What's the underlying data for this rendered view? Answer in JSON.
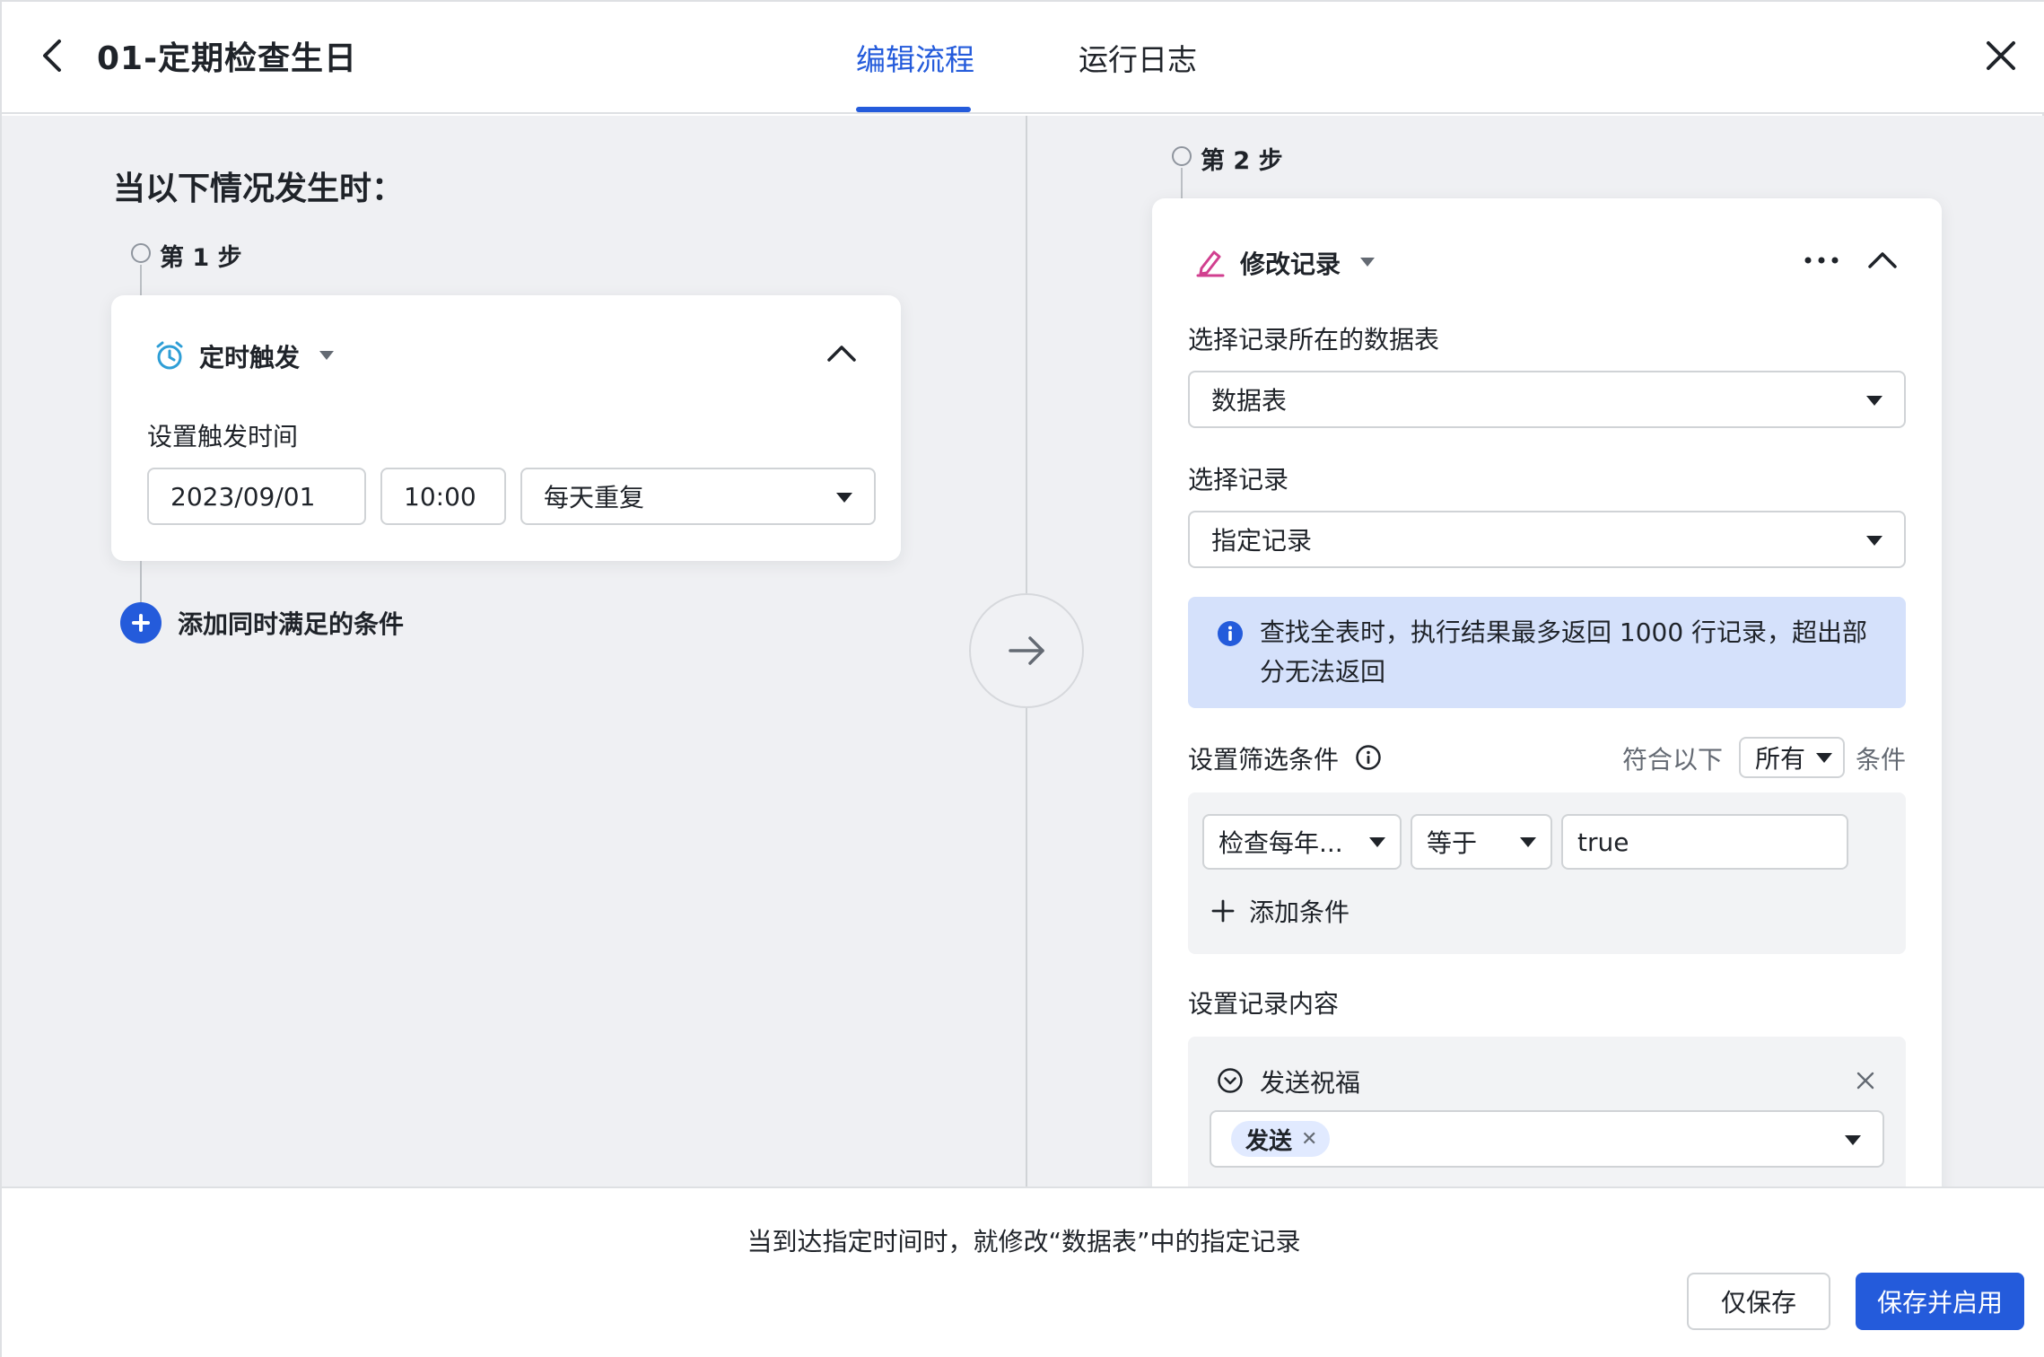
{
  "header": {
    "title": "01-定期检查生日",
    "tabs": [
      {
        "label": "编辑流程",
        "active": true
      },
      {
        "label": "运行日志",
        "active": false
      }
    ]
  },
  "left": {
    "heading": "当以下情况发生时：",
    "step1": {
      "label": "第 1 步",
      "card": {
        "icon": "alarm-clock-icon",
        "title": "定时触发",
        "field_label": "设置触发时间",
        "date": "2023/09/01",
        "time": "10:00",
        "repeat": "每天重复"
      }
    },
    "add_condition_label": "添加同时满足的条件"
  },
  "right": {
    "step2": {
      "label": "第 2 步",
      "card": {
        "icon": "edit-pencil-icon",
        "title": "修改记录",
        "table_label": "选择记录所在的数据表",
        "table_value": "数据表",
        "record_label": "选择记录",
        "record_value": "指定记录",
        "info_text": "查找全表时，执行结果最多返回 1000 行记录，超出部分无法返回",
        "filter_label": "设置筛选条件",
        "match_prefix": "符合以下",
        "match_value": "所有",
        "match_suffix": "条件",
        "condition": {
          "field": "检查每年...",
          "operator": "等于",
          "value": "true"
        },
        "add_condition": "添加条件",
        "content_label": "设置记录内容",
        "content_field": "发送祝福",
        "content_tag": "发送"
      }
    }
  },
  "footer": {
    "summary": "当到达指定时间时，就修改“数据表”中的指定记录",
    "save_only": "仅保存",
    "save_enable": "保存并启用"
  },
  "colors": {
    "primary": "#245bdb",
    "canvas_bg": "#eff0f3",
    "info_bg": "#d5e1fb",
    "trigger_icon": "#2e9ed6",
    "action_icon": "#d13f8f"
  }
}
